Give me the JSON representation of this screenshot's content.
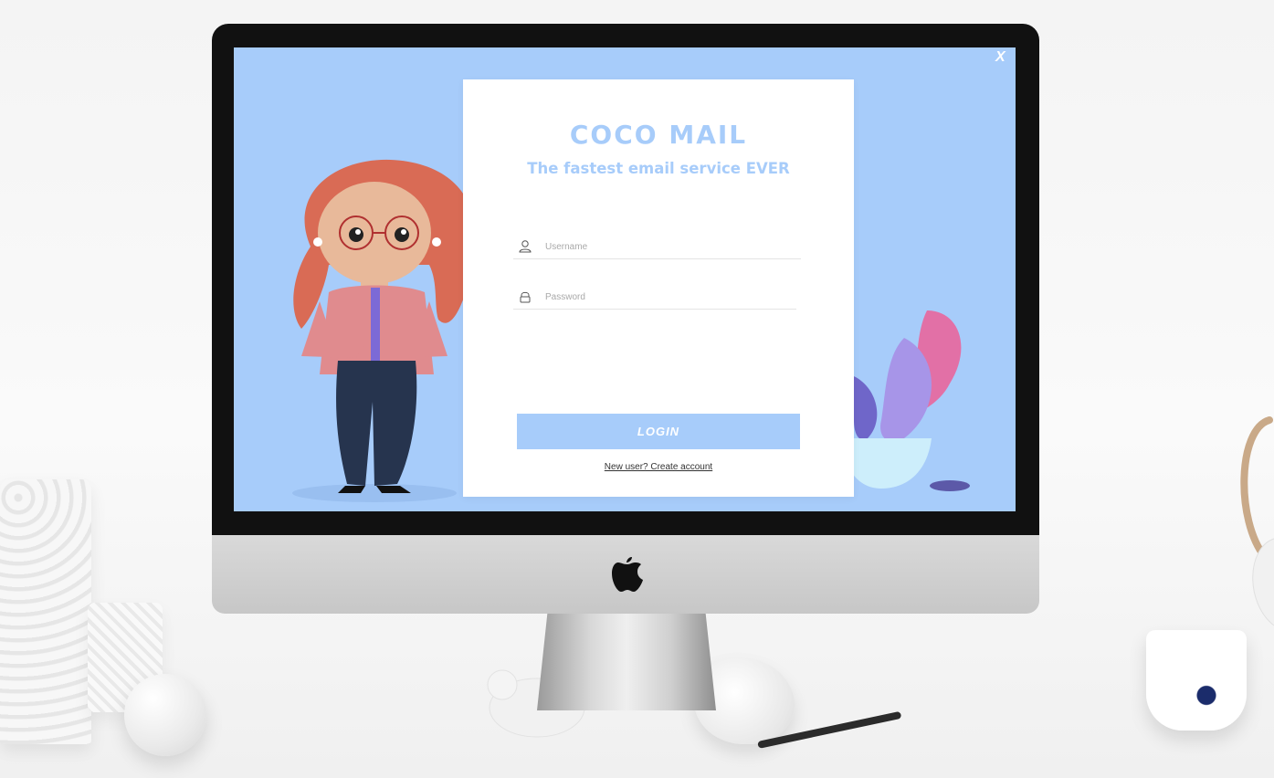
{
  "window": {
    "close_label": "X"
  },
  "login": {
    "brand": "COCO MAIL",
    "tagline": "The fastest email service EVER",
    "username_placeholder": "Username",
    "password_placeholder": "Password",
    "login_label": "LOGIN",
    "create_account_label": "New user? Create account"
  },
  "icons": {
    "username": "user-icon",
    "password": "lock-icon",
    "monitor": "apple-logo"
  },
  "colors": {
    "accent": "#a7ccfa",
    "card": "#ffffff",
    "bezel": "#111111"
  }
}
